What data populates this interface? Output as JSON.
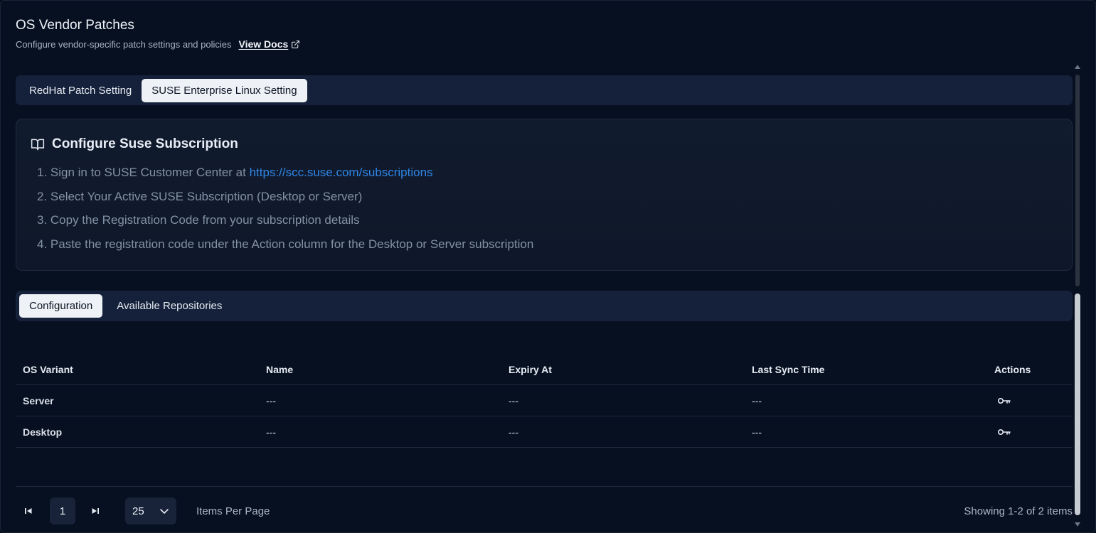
{
  "header": {
    "title": "OS Vendor Patches",
    "subtitle": "Configure vendor-specific patch settings and policies",
    "docs_link": "View Docs"
  },
  "vendor_tabs": [
    {
      "label": "RedHat Patch Setting",
      "active": false
    },
    {
      "label": "SUSE Enterprise Linux Setting",
      "active": true
    }
  ],
  "subscription_card": {
    "icon": "book-open-icon",
    "title": "Configure Suse Subscription",
    "steps": [
      {
        "prefix": "1. Sign in to SUSE Customer Center at ",
        "link": "https://scc.suse.com/subscriptions"
      },
      {
        "text": "2. Select Your Active SUSE Subscription (Desktop or Server)"
      },
      {
        "text": "3. Copy the Registration Code from your subscription details"
      },
      {
        "text": "4. Paste the registration code under the Action column for the Desktop or Server subscription"
      }
    ]
  },
  "sub_tabs": [
    {
      "label": "Configuration",
      "active": true
    },
    {
      "label": "Available Repositories",
      "active": false
    }
  ],
  "table": {
    "columns": [
      "OS Variant",
      "Name",
      "Expiry At",
      "Last Sync Time",
      "Actions"
    ],
    "rows": [
      {
        "os_variant": "Server",
        "name": "---",
        "expiry_at": "---",
        "last_sync": "---",
        "action_icon": "key-icon"
      },
      {
        "os_variant": "Desktop",
        "name": "---",
        "expiry_at": "---",
        "last_sync": "---",
        "action_icon": "key-icon"
      }
    ]
  },
  "pagination": {
    "current_page": "1",
    "per_page": "25",
    "per_page_label": "Items Per Page",
    "showing": "Showing 1-2 of 2 items"
  },
  "colors": {
    "background": "#071021",
    "link": "#2f86e6",
    "active_tab": "#eef1f6"
  }
}
